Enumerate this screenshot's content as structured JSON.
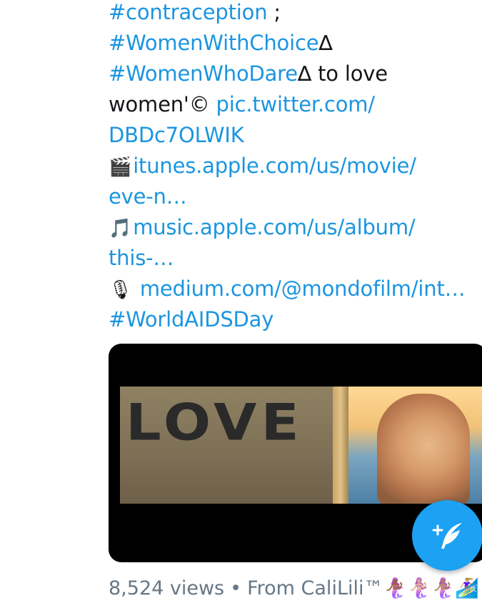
{
  "tweet": {
    "lines": [
      {
        "parts": [
          {
            "text": "#contraception",
            "type": "link"
          },
          {
            "text": " ;",
            "type": "plain"
          }
        ]
      },
      {
        "parts": [
          {
            "text": "#WomenWithChoice",
            "type": "link"
          },
          {
            "text": "∆",
            "type": "plain"
          }
        ]
      },
      {
        "parts": [
          {
            "text": "#WomenWhoDare",
            "type": "link"
          },
          {
            "text": "∆ to love",
            "type": "plain"
          }
        ]
      },
      {
        "parts": [
          {
            "text": "women'©  ",
            "type": "plain"
          },
          {
            "text": "pic.twitter.com/",
            "type": "link"
          }
        ]
      },
      {
        "parts": [
          {
            "text": "DBDc7OLWIK",
            "type": "link"
          }
        ]
      },
      {
        "parts": [
          {
            "text": "🎬",
            "type": "emoji"
          },
          {
            "text": "itunes.apple.com/us/movie/",
            "type": "link"
          }
        ]
      },
      {
        "parts": [
          {
            "text": "eve-n…",
            "type": "link"
          }
        ]
      },
      {
        "parts": [
          {
            "text": "🎵",
            "type": "emoji"
          },
          {
            "text": "music.apple.com/us/album/",
            "type": "link"
          }
        ]
      },
      {
        "parts": [
          {
            "text": "this-…",
            "type": "link"
          }
        ]
      },
      {
        "parts": [
          {
            "text": "🎙",
            "type": "emoji"
          },
          {
            "text": " medium.com/@mondofilm/int…",
            "type": "link"
          }
        ]
      },
      {
        "parts": [
          {
            "text": "#WorldAIDSDay",
            "type": "link"
          }
        ]
      }
    ]
  },
  "media": {
    "frame_text": "LOVE"
  },
  "footer": {
    "views": "8,524 views",
    "separator": "•",
    "source": "From CaliLili™🧜🏾‍♀️🧜🏼‍♀️🧜🏽‍♀️🏄🏼‍♀️…"
  },
  "fab": {
    "icon": "compose-tweet-icon"
  },
  "colors": {
    "link": "#1b95e0",
    "text": "#14171a",
    "meta": "#657786",
    "fab": "#1da1f2"
  }
}
